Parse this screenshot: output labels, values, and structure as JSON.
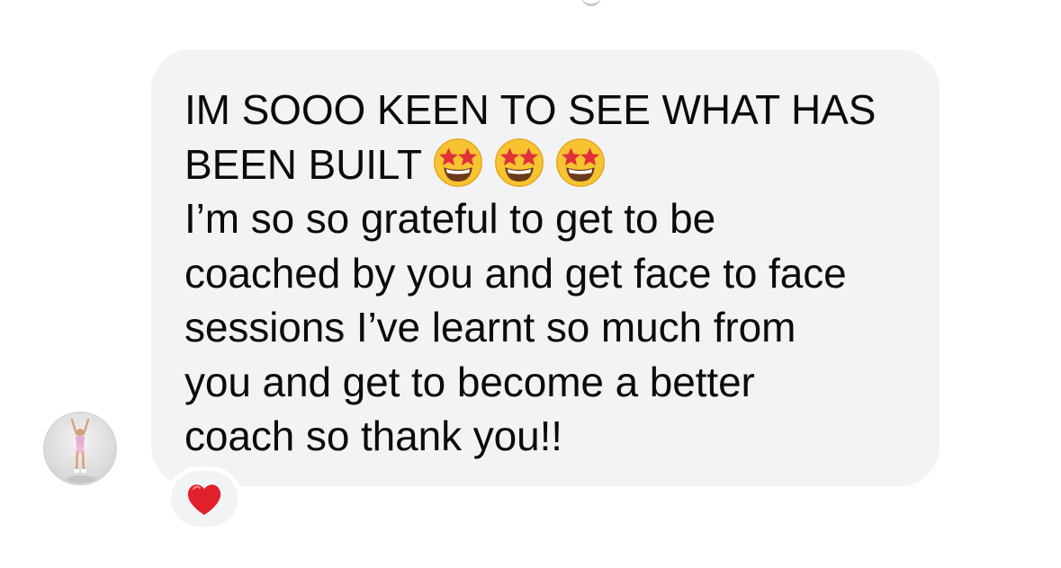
{
  "message": {
    "line1": "IM SOOO KEEN TO SEE WHAT HAS",
    "line2": "BEEN BUILT",
    "line2_emojis": [
      "star-struck-emoji",
      "star-struck-emoji",
      "star-struck-emoji"
    ],
    "line3": "I’m so so grateful to get to be",
    "line4": "coached by you and get face to face",
    "line5": "sessions I’ve learnt so much from",
    "line6": "you and get to become a better",
    "line7": "coach so thank you!!"
  },
  "reaction": {
    "icon": "red-heart-icon",
    "color": "#e0202a"
  },
  "avatar": {
    "icon": "profile-photo-person-arms-raised"
  },
  "colors": {
    "bubble": "#f2f3f5",
    "text": "#0b0b0b",
    "background": "#ffffff"
  }
}
